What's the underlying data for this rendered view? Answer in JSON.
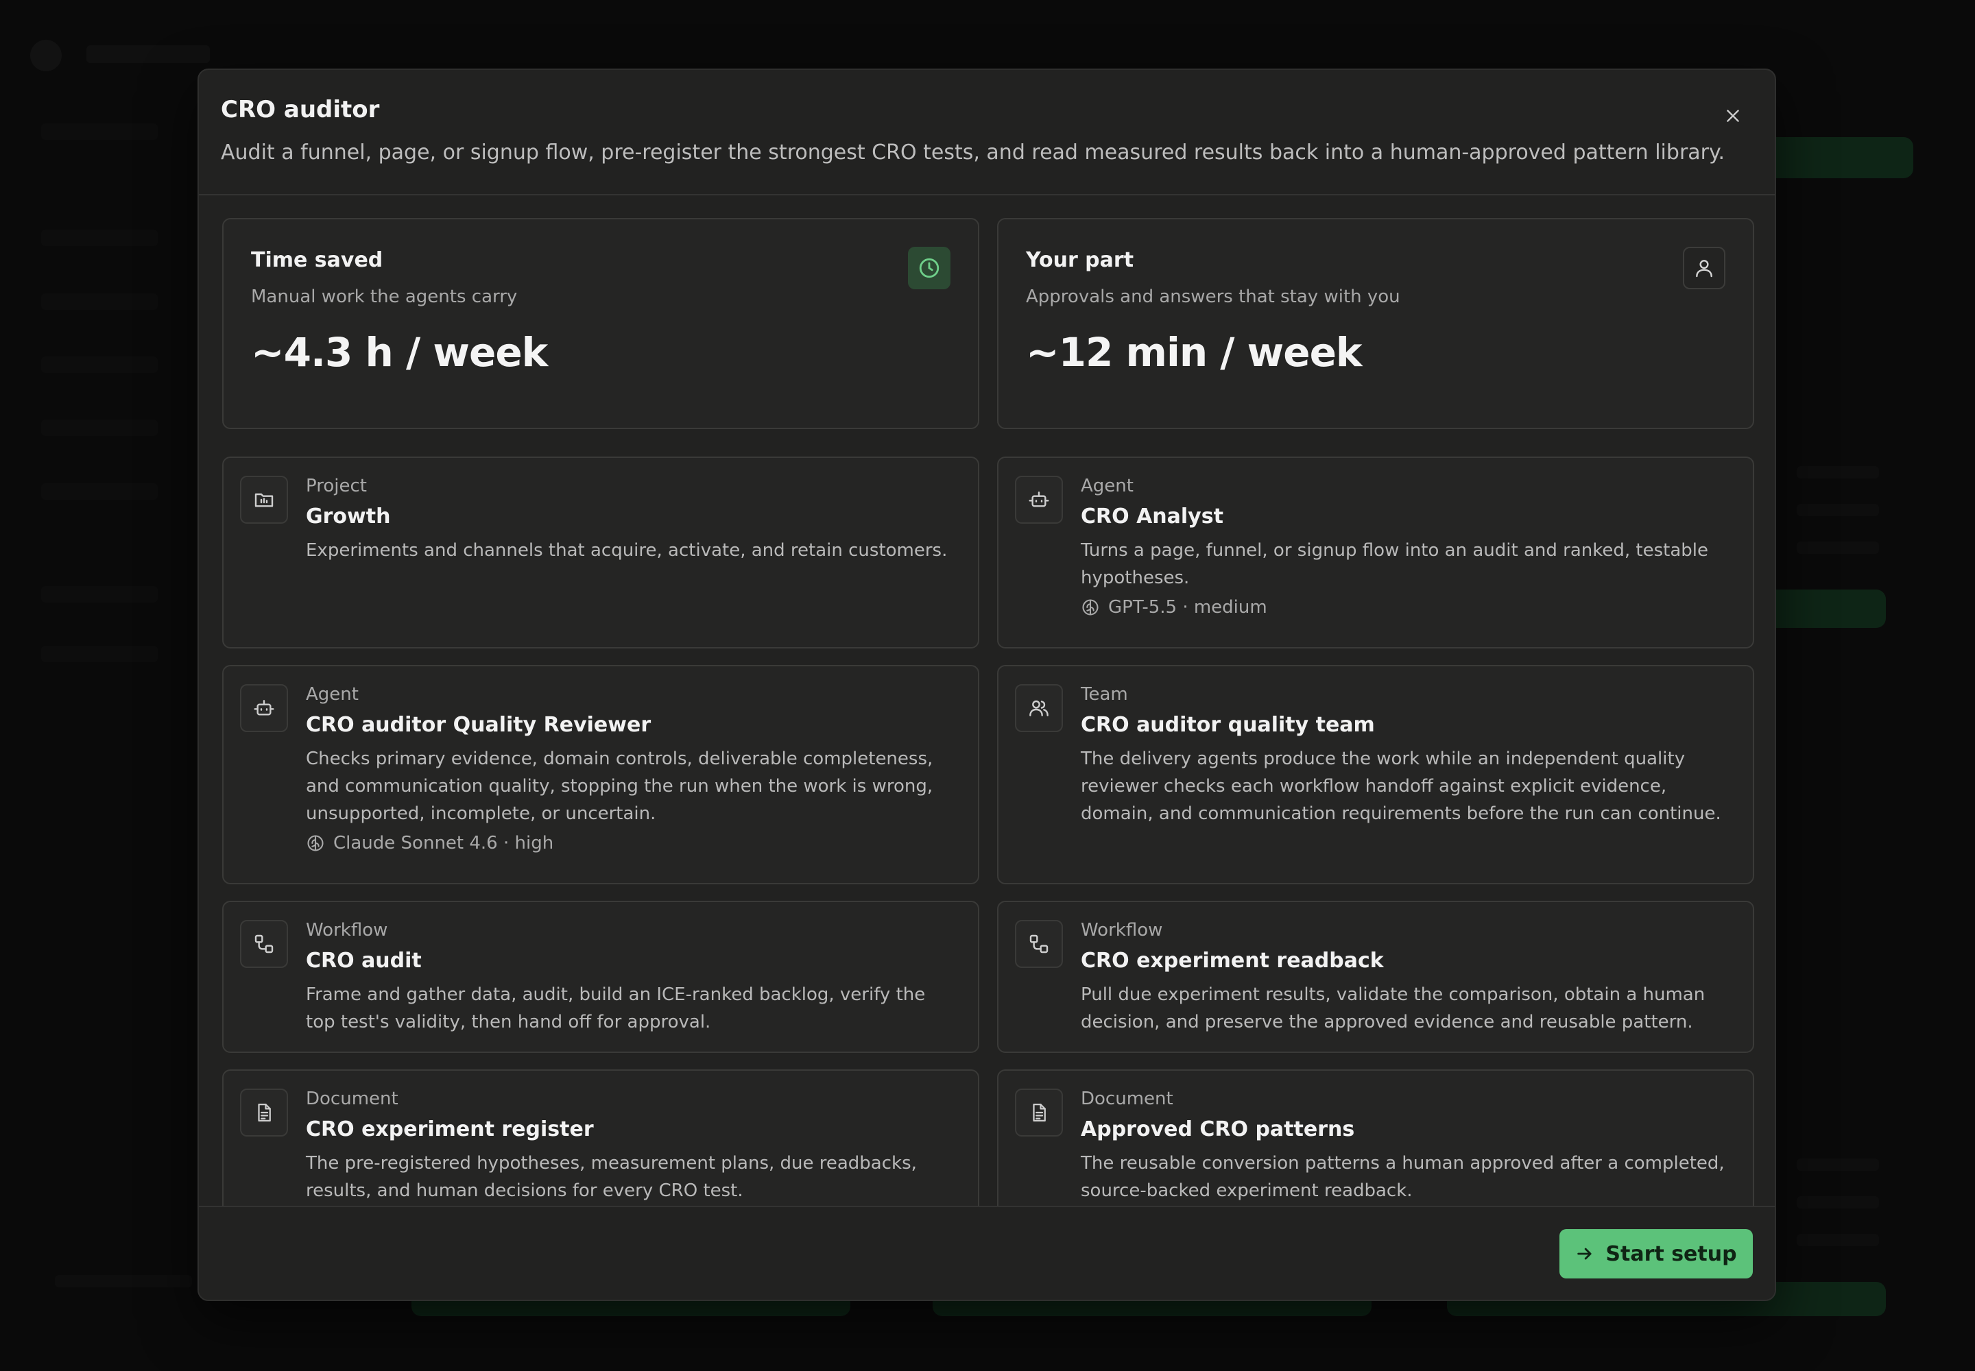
{
  "modal": {
    "title": "CRO auditor",
    "description": "Audit a funnel, page, or signup flow, pre-register the strongest CRO tests, and read measured results back into a human-approved pattern library."
  },
  "stats": {
    "time_saved": {
      "title": "Time saved",
      "subtitle": "Manual work the agents carry",
      "value": "~4.3 h / week",
      "icon": "clock-icon",
      "accent": "#5cc27a"
    },
    "your_part": {
      "title": "Your part",
      "subtitle": "Approvals and answers that stay with you",
      "value": "~12 min / week",
      "icon": "user-icon"
    }
  },
  "items": [
    {
      "type": "Project",
      "title": "Growth",
      "description": "Experiments and channels that acquire, activate, and retain customers.",
      "icon": "folder-icon"
    },
    {
      "type": "Agent",
      "title": "CRO Analyst",
      "description": "Turns a page, funnel, or signup flow into an audit and ranked, testable hypotheses.",
      "model": "GPT-5.5 · medium",
      "icon": "bot-icon"
    },
    {
      "type": "Agent",
      "title": "CRO auditor Quality Reviewer",
      "description": "Checks primary evidence, domain controls, deliverable completeness, and communication quality, stopping the run when the work is wrong, unsupported, incomplete, or uncertain.",
      "model": "Claude Sonnet 4.6 · high",
      "icon": "bot-icon"
    },
    {
      "type": "Team",
      "title": "CRO auditor quality team",
      "description": "The delivery agents produce the work while an independent quality reviewer checks each workflow handoff against explicit evidence, domain, and communication requirements before the run can continue.",
      "icon": "users-icon"
    },
    {
      "type": "Workflow",
      "title": "CRO audit",
      "description": "Frame and gather data, audit, build an ICE-ranked backlog, verify the top test's validity, then hand off for approval.",
      "icon": "workflow-icon"
    },
    {
      "type": "Workflow",
      "title": "CRO experiment readback",
      "description": "Pull due experiment results, validate the comparison, obtain a human decision, and preserve the approved evidence and reusable pattern.",
      "icon": "workflow-icon"
    },
    {
      "type": "Document",
      "title": "CRO experiment register",
      "description": "The pre-registered hypotheses, measurement plans, due readbacks, results, and human decisions for every CRO test.",
      "icon": "document-icon"
    },
    {
      "type": "Document",
      "title": "Approved CRO patterns",
      "description": "The reusable conversion patterns a human approved after a completed, source-backed experiment readback.",
      "icon": "document-icon"
    }
  ],
  "footer": {
    "start_label": "Start setup",
    "button_color": "#5cc27a"
  }
}
